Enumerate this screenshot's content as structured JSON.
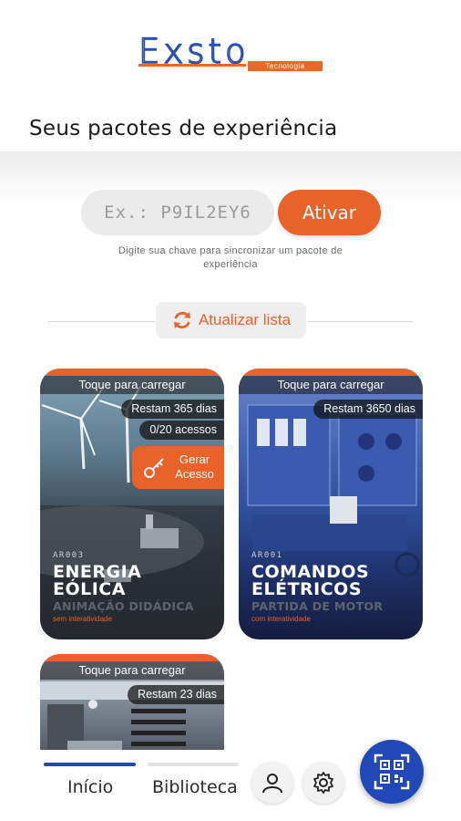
{
  "brand": {
    "logo_text": "Exsto",
    "logo_tagline": "Tecnologia",
    "accent_color": "#e8622a",
    "primary_color": "#2148b6"
  },
  "page_title": "Seus pacotes de experiência",
  "activation": {
    "placeholder": "Ex.: P9IL2EY6",
    "button_label": "Ativar",
    "hint": "Digite sua chave para sincronizar um pacote de experiência"
  },
  "refresh": {
    "label": "Atualizar lista",
    "icon": "refresh-icon"
  },
  "cards": [
    {
      "tap_label": "Toque para carregar",
      "days": "Restam 365 dias",
      "accesses": "0/20 acessos",
      "generate_label_1": "Gerar",
      "generate_label_2": "Acesso",
      "code": "AR003",
      "name_line1": "ENERGIA",
      "name_line2": "EÓLICA",
      "subtitle": "ANIMAÇÃO DIDÁDICA",
      "interactivity": "sem interatividade"
    },
    {
      "tap_label": "Toque para carregar",
      "days": "Restam 3650 dias",
      "code": "AR001",
      "name_line1": "COMANDOS",
      "name_line2": "ELÉTRICOS",
      "subtitle": "PARTIDA DE MOTOR",
      "interactivity": "com interatividade"
    },
    {
      "tap_label": "Toque para carregar",
      "days": "Restam 23 dias"
    }
  ],
  "nav": {
    "tab_home": "Início",
    "tab_library": "Biblioteca",
    "active_tab": "Início",
    "profile_icon": "person-icon",
    "settings_icon": "gear-icon",
    "qr_icon": "qr-scan-icon"
  }
}
